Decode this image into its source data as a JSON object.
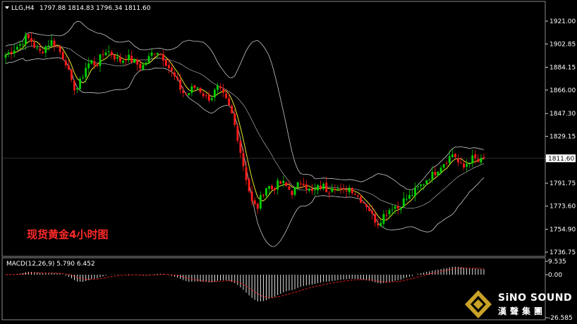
{
  "header": {
    "symbol_label": "LLG,H4",
    "ohlc_text": "1797.88 1814.83 1796.34 1811.60"
  },
  "price_axis": {
    "ticks": [
      "1921.00",
      "1902.85",
      "1884.15",
      "1866.00",
      "1847.30",
      "1829.15",
      "1811.60",
      "1791.75",
      "1773.60",
      "1754.90",
      "1736.75"
    ],
    "current_price_label": "1811.60"
  },
  "macd": {
    "label": "MACD(12,26,9) 5.790 6.452",
    "axis_ticks": [
      "9.535",
      "0.00",
      "-26.585"
    ]
  },
  "annotation": {
    "title": "现货黄金4小时图"
  },
  "logo": {
    "brand_en": "SiNO SOUND",
    "brand_cn": "漢聲集團"
  },
  "colors": {
    "background": "#000000",
    "bull_candle": "#00d000",
    "bear_candle": "#ff1a1a",
    "bollinger": "#c8c8c8",
    "moving_average": "#ffff33",
    "macd_hist": "#ffffff",
    "macd_signal": "#ff2020",
    "axis_text": "#ffffff",
    "price_box": "#ffffff"
  },
  "chart_data": {
    "type": "candlestick",
    "symbol": "LLG",
    "timeframe": "H4",
    "ylim": [
      1736.75,
      1921.0
    ],
    "last_close": 1811.6,
    "close_path": [
      1894,
      1897,
      1900,
      1903,
      1908,
      1906,
      1899,
      1896,
      1901,
      1905,
      1902,
      1895,
      1888,
      1872,
      1866,
      1874,
      1885,
      1889,
      1886,
      1893,
      1898,
      1895,
      1891,
      1889,
      1893,
      1890,
      1887,
      1884,
      1889,
      1895,
      1898,
      1894,
      1887,
      1880,
      1873,
      1865,
      1862,
      1867,
      1869,
      1864,
      1859,
      1861,
      1868,
      1863,
      1856,
      1846,
      1830,
      1810,
      1792,
      1775,
      1772,
      1784,
      1790,
      1787,
      1791,
      1792,
      1788,
      1784,
      1790,
      1794,
      1787,
      1784,
      1788,
      1790,
      1785,
      1791,
      1787,
      1784,
      1789,
      1786,
      1781,
      1777,
      1773,
      1764,
      1760,
      1766,
      1770,
      1774,
      1772,
      1778,
      1780,
      1784,
      1788,
      1792,
      1797,
      1799,
      1804,
      1808,
      1812,
      1816,
      1807,
      1804,
      1810,
      1812,
      1808,
      1811.6
    ],
    "macd": {
      "params": "12,26,9",
      "main": 5.79,
      "signal": 6.452,
      "ylim": [
        -26.585,
        9.535
      ]
    }
  }
}
